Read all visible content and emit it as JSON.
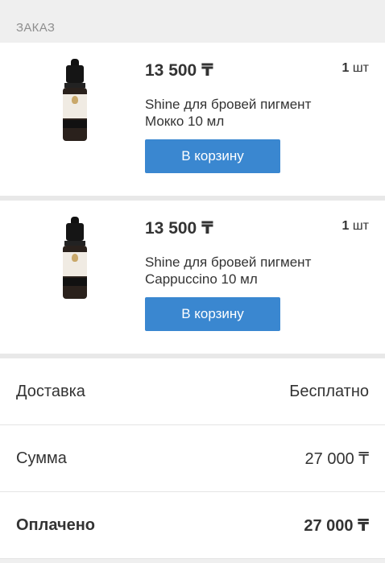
{
  "section_title": "ЗАКАЗ",
  "items": [
    {
      "price": "13 500 ₸",
      "qty_number": "1",
      "qty_unit": "шт",
      "title": "Shine для бровей пигмент Мокко 10 мл",
      "cart_label": "В корзину"
    },
    {
      "price": "13 500 ₸",
      "qty_number": "1",
      "qty_unit": "шт",
      "title": "Shine для бровей пигмент Cappuccino 10 мл",
      "cart_label": "В корзину"
    }
  ],
  "summary": [
    {
      "label": "Доставка",
      "value": "Бесплатно"
    },
    {
      "label": "Сумма",
      "value": "27 000 ₸"
    },
    {
      "label": "Оплачено",
      "value": "27 000 ₸"
    }
  ],
  "colors": {
    "button": "#3a87d0",
    "background": "#efefef"
  }
}
